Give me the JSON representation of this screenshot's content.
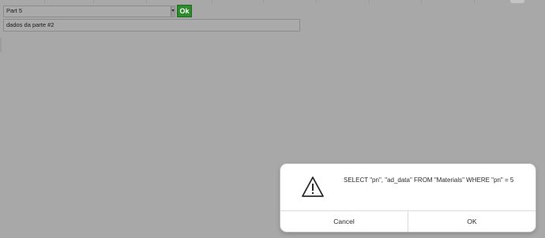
{
  "form": {
    "combo_value": "Part 5",
    "ok_label": "Ok",
    "text_field_value": "dados da parte #2"
  },
  "dialog": {
    "icon": "warning-icon",
    "message": "SELECT \"pn\", \"ad_data\" FROM \"Materials\" WHERE \"pn\" = 5",
    "cancel_label": "Cancel",
    "ok_label": "OK"
  },
  "colors": {
    "backdrop": "#a8a8a8",
    "ok_button_green": "#2d8a2d",
    "dialog_bg": "#ffffff"
  }
}
